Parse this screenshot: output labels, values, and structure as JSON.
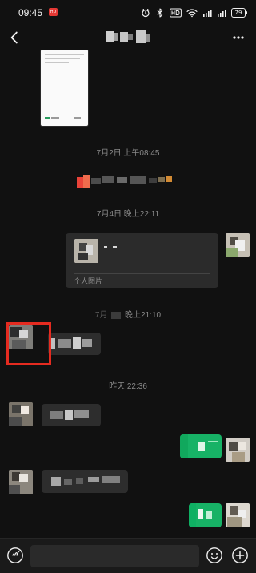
{
  "status_bar": {
    "time": "09:45",
    "battery": "79"
  },
  "header": {
    "back_icon": "chevron-left-icon",
    "more_icon": "more-dots-icon"
  },
  "timestamps": [
    "7月2日 上午08:45",
    "7月4日 晚上22:11",
    "晚上21:10",
    "昨天 22:36"
  ],
  "link_card": {
    "source": "个人图片"
  },
  "input_bar": {
    "placeholder": "",
    "voice_icon": "voice-icon",
    "emoji_icon": "emoji-icon",
    "plus_icon": "plus-icon"
  },
  "colors": {
    "background": "#111111",
    "incoming_bubble": "#2d2d2d",
    "outgoing_bubble": "#17b266",
    "highlight": "#e52b20",
    "timestamp": "#8a8a8a"
  }
}
